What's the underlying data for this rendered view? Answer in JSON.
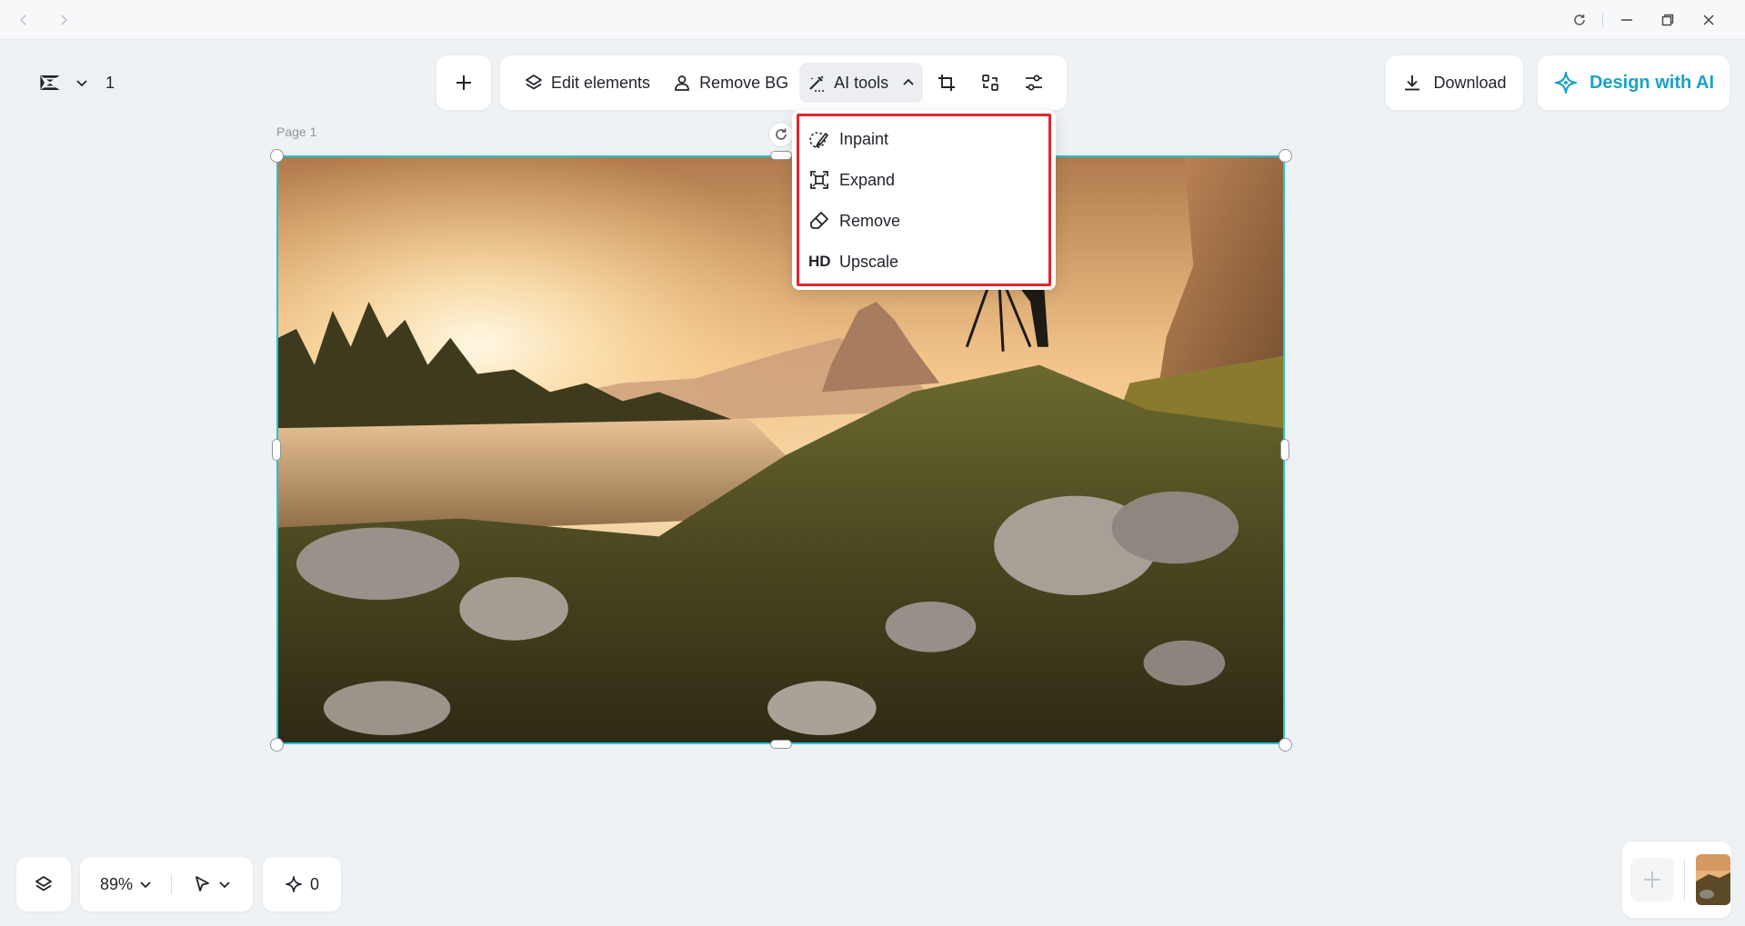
{
  "window": {
    "back_icon": "chevron-left-icon",
    "forward_icon": "chevron-right-icon",
    "reload_icon": "reload-icon",
    "minimize_icon": "minimize-icon",
    "restore_icon": "restore-icon",
    "close_icon": "close-icon"
  },
  "header": {
    "page_count": "1",
    "toolbar": {
      "edit_elements": "Edit elements",
      "remove_bg": "Remove BG",
      "ai_tools": "AI tools"
    },
    "download": "Download",
    "design_with_ai": "Design with AI"
  },
  "canvas": {
    "page_label": "Page 1"
  },
  "ai_tools_menu": {
    "items": [
      {
        "label": "Inpaint",
        "icon": "inpaint-icon"
      },
      {
        "label": "Expand",
        "icon": "expand-icon"
      },
      {
        "label": "Remove",
        "icon": "eraser-icon"
      },
      {
        "label": "Upscale",
        "badge": "HD"
      }
    ]
  },
  "bottom": {
    "zoom": "89%",
    "sparkle_count": "0"
  },
  "colors": {
    "accent": "#22c3d8",
    "ai_brand": "#1aa3c6",
    "highlight": "#e0282e"
  }
}
